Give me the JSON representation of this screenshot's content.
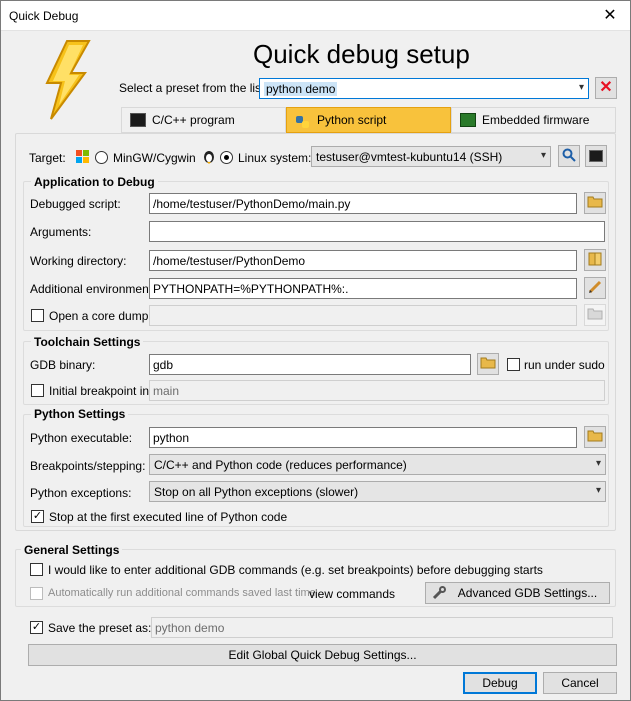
{
  "window": {
    "title": "Quick Debug",
    "close_glyph": "✕"
  },
  "header": {
    "heading": "Quick debug setup",
    "preset_label": "Select a preset from the list:",
    "preset_value": "python demo",
    "delete_icon": "delete-preset-icon",
    "logo_icon": "lightning-bolt-icon"
  },
  "tabs": [
    {
      "label": "C/C++ program",
      "icon": "terminal-icon"
    },
    {
      "label": "Python script",
      "icon": "python-icon"
    },
    {
      "label": "Embedded firmware",
      "icon": "chip-icon"
    }
  ],
  "target": {
    "label": "Target:",
    "mingw_label": "MinGW/Cygwin",
    "linux_label": "Linux system:",
    "system_value": "testuser@vmtest-kubuntu14 (SSH)"
  },
  "app_section": {
    "title": "Application to Debug",
    "script_label": "Debugged script:",
    "script_value": "/home/testuser/PythonDemo/main.py",
    "args_label": "Arguments:",
    "args_value": "",
    "workdir_label": "Working directory:",
    "workdir_value": "/home/testuser/PythonDemo",
    "env_label": "Additional environment:",
    "env_value": "PYTHONPATH=%PYTHONPATH%:.",
    "core_dump_label": "Open a core dump:",
    "core_dump_value": ""
  },
  "toolchain_section": {
    "title": "Toolchain Settings",
    "gdb_label": "GDB binary:",
    "gdb_value": "gdb",
    "sudo_label": "run under sudo",
    "breakpoint_label": "Initial breakpoint in:",
    "breakpoint_value": "main"
  },
  "python_section": {
    "title": "Python Settings",
    "exe_label": "Python executable:",
    "exe_value": "python",
    "stepping_label": "Breakpoints/stepping:",
    "stepping_value": "C/C++ and Python code (reduces performance)",
    "exceptions_label": "Python exceptions:",
    "exceptions_value": "Stop on all Python exceptions (slower)",
    "stop_first_label": "Stop at the first executed line of Python code",
    "stop_first_checked": true
  },
  "general_section": {
    "title": "General Settings",
    "additional_cmds_label": "I would like to enter additional GDB commands (e.g. set breakpoints) before debugging starts",
    "auto_run_label": "Automatically run additional commands saved last time",
    "view_commands_label": "view commands",
    "advanced_button": "Advanced GDB Settings..."
  },
  "footer": {
    "save_preset_label": "Save the preset as:",
    "save_preset_checked": true,
    "save_preset_value": "python demo",
    "global_button": "Edit Global Quick Debug Settings...",
    "debug_button": "Debug",
    "cancel_button": "Cancel"
  },
  "colors": {
    "active_tab": "#f8c23c",
    "accent": "#0078d7",
    "delete_red": "#e81123",
    "folder_yellow": "#e8b84a"
  }
}
